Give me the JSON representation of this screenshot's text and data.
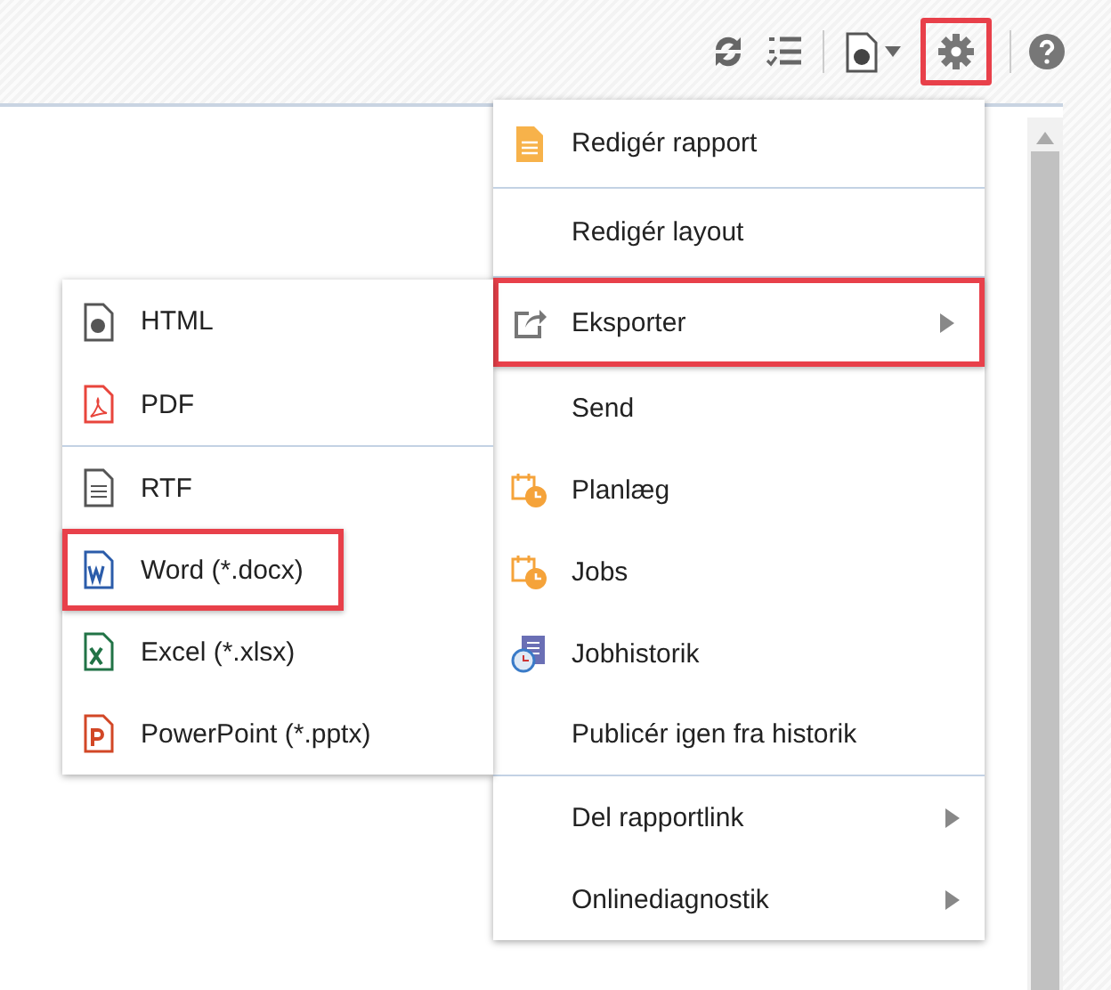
{
  "toolbar": {
    "settings_highlighted": true
  },
  "menu": {
    "items": [
      {
        "label": "Redigér rapport",
        "has_submenu": false,
        "highlighted": false,
        "divider_after": true
      },
      {
        "label": "Redigér layout",
        "has_submenu": false,
        "highlighted": false,
        "divider_after": true
      },
      {
        "label": "Eksporter",
        "has_submenu": true,
        "highlighted": true,
        "divider_after": false
      },
      {
        "label": "Send",
        "has_submenu": false,
        "highlighted": false,
        "divider_after": false
      },
      {
        "label": "Planlæg",
        "has_submenu": false,
        "highlighted": false,
        "divider_after": false
      },
      {
        "label": "Jobs",
        "has_submenu": false,
        "highlighted": false,
        "divider_after": false
      },
      {
        "label": "Jobhistorik",
        "has_submenu": false,
        "highlighted": false,
        "divider_after": false
      },
      {
        "label": "Publicér igen fra historik",
        "has_submenu": false,
        "highlighted": false,
        "divider_after": true
      },
      {
        "label": "Del rapportlink",
        "has_submenu": true,
        "highlighted": false,
        "divider_after": false
      },
      {
        "label": "Onlinediagnostik",
        "has_submenu": true,
        "highlighted": false,
        "divider_after": false
      }
    ]
  },
  "submenu": {
    "items": [
      {
        "label": "HTML",
        "highlighted": false,
        "divider_after": false
      },
      {
        "label": "PDF",
        "highlighted": false,
        "divider_after": true
      },
      {
        "label": "RTF",
        "highlighted": false,
        "divider_after": false
      },
      {
        "label": "Word (*.docx)",
        "highlighted": true,
        "divider_after": false
      },
      {
        "label": "Excel (*.xlsx)",
        "highlighted": false,
        "divider_after": false
      },
      {
        "label": "PowerPoint (*.pptx)",
        "highlighted": false,
        "divider_after": false
      }
    ]
  }
}
